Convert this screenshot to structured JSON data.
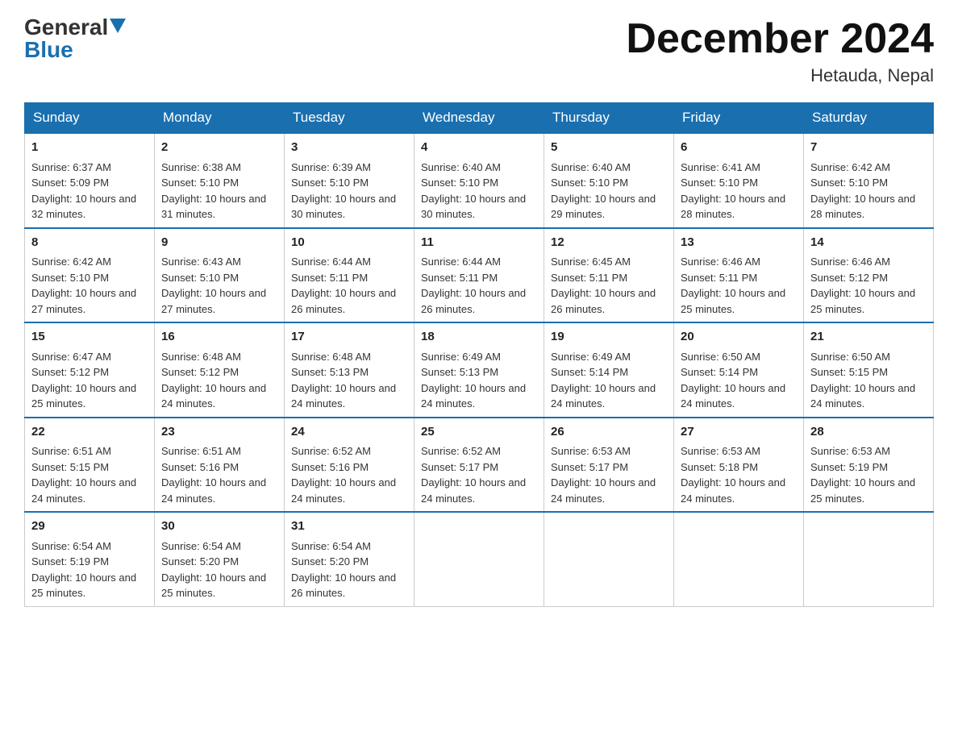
{
  "header": {
    "logo_general": "General",
    "logo_blue": "Blue",
    "month_title": "December 2024",
    "location": "Hetauda, Nepal"
  },
  "days_of_week": [
    "Sunday",
    "Monday",
    "Tuesday",
    "Wednesday",
    "Thursday",
    "Friday",
    "Saturday"
  ],
  "weeks": [
    [
      {
        "day": 1,
        "sunrise": "6:37 AM",
        "sunset": "5:09 PM",
        "daylight": "10 hours and 32 minutes."
      },
      {
        "day": 2,
        "sunrise": "6:38 AM",
        "sunset": "5:10 PM",
        "daylight": "10 hours and 31 minutes."
      },
      {
        "day": 3,
        "sunrise": "6:39 AM",
        "sunset": "5:10 PM",
        "daylight": "10 hours and 30 minutes."
      },
      {
        "day": 4,
        "sunrise": "6:40 AM",
        "sunset": "5:10 PM",
        "daylight": "10 hours and 30 minutes."
      },
      {
        "day": 5,
        "sunrise": "6:40 AM",
        "sunset": "5:10 PM",
        "daylight": "10 hours and 29 minutes."
      },
      {
        "day": 6,
        "sunrise": "6:41 AM",
        "sunset": "5:10 PM",
        "daylight": "10 hours and 28 minutes."
      },
      {
        "day": 7,
        "sunrise": "6:42 AM",
        "sunset": "5:10 PM",
        "daylight": "10 hours and 28 minutes."
      }
    ],
    [
      {
        "day": 8,
        "sunrise": "6:42 AM",
        "sunset": "5:10 PM",
        "daylight": "10 hours and 27 minutes."
      },
      {
        "day": 9,
        "sunrise": "6:43 AM",
        "sunset": "5:10 PM",
        "daylight": "10 hours and 27 minutes."
      },
      {
        "day": 10,
        "sunrise": "6:44 AM",
        "sunset": "5:11 PM",
        "daylight": "10 hours and 26 minutes."
      },
      {
        "day": 11,
        "sunrise": "6:44 AM",
        "sunset": "5:11 PM",
        "daylight": "10 hours and 26 minutes."
      },
      {
        "day": 12,
        "sunrise": "6:45 AM",
        "sunset": "5:11 PM",
        "daylight": "10 hours and 26 minutes."
      },
      {
        "day": 13,
        "sunrise": "6:46 AM",
        "sunset": "5:11 PM",
        "daylight": "10 hours and 25 minutes."
      },
      {
        "day": 14,
        "sunrise": "6:46 AM",
        "sunset": "5:12 PM",
        "daylight": "10 hours and 25 minutes."
      }
    ],
    [
      {
        "day": 15,
        "sunrise": "6:47 AM",
        "sunset": "5:12 PM",
        "daylight": "10 hours and 25 minutes."
      },
      {
        "day": 16,
        "sunrise": "6:48 AM",
        "sunset": "5:12 PM",
        "daylight": "10 hours and 24 minutes."
      },
      {
        "day": 17,
        "sunrise": "6:48 AM",
        "sunset": "5:13 PM",
        "daylight": "10 hours and 24 minutes."
      },
      {
        "day": 18,
        "sunrise": "6:49 AM",
        "sunset": "5:13 PM",
        "daylight": "10 hours and 24 minutes."
      },
      {
        "day": 19,
        "sunrise": "6:49 AM",
        "sunset": "5:14 PM",
        "daylight": "10 hours and 24 minutes."
      },
      {
        "day": 20,
        "sunrise": "6:50 AM",
        "sunset": "5:14 PM",
        "daylight": "10 hours and 24 minutes."
      },
      {
        "day": 21,
        "sunrise": "6:50 AM",
        "sunset": "5:15 PM",
        "daylight": "10 hours and 24 minutes."
      }
    ],
    [
      {
        "day": 22,
        "sunrise": "6:51 AM",
        "sunset": "5:15 PM",
        "daylight": "10 hours and 24 minutes."
      },
      {
        "day": 23,
        "sunrise": "6:51 AM",
        "sunset": "5:16 PM",
        "daylight": "10 hours and 24 minutes."
      },
      {
        "day": 24,
        "sunrise": "6:52 AM",
        "sunset": "5:16 PM",
        "daylight": "10 hours and 24 minutes."
      },
      {
        "day": 25,
        "sunrise": "6:52 AM",
        "sunset": "5:17 PM",
        "daylight": "10 hours and 24 minutes."
      },
      {
        "day": 26,
        "sunrise": "6:53 AM",
        "sunset": "5:17 PM",
        "daylight": "10 hours and 24 minutes."
      },
      {
        "day": 27,
        "sunrise": "6:53 AM",
        "sunset": "5:18 PM",
        "daylight": "10 hours and 24 minutes."
      },
      {
        "day": 28,
        "sunrise": "6:53 AM",
        "sunset": "5:19 PM",
        "daylight": "10 hours and 25 minutes."
      }
    ],
    [
      {
        "day": 29,
        "sunrise": "6:54 AM",
        "sunset": "5:19 PM",
        "daylight": "10 hours and 25 minutes."
      },
      {
        "day": 30,
        "sunrise": "6:54 AM",
        "sunset": "5:20 PM",
        "daylight": "10 hours and 25 minutes."
      },
      {
        "day": 31,
        "sunrise": "6:54 AM",
        "sunset": "5:20 PM",
        "daylight": "10 hours and 26 minutes."
      },
      null,
      null,
      null,
      null
    ]
  ],
  "labels": {
    "sunrise_prefix": "Sunrise: ",
    "sunset_prefix": "Sunset: ",
    "daylight_prefix": "Daylight: "
  }
}
